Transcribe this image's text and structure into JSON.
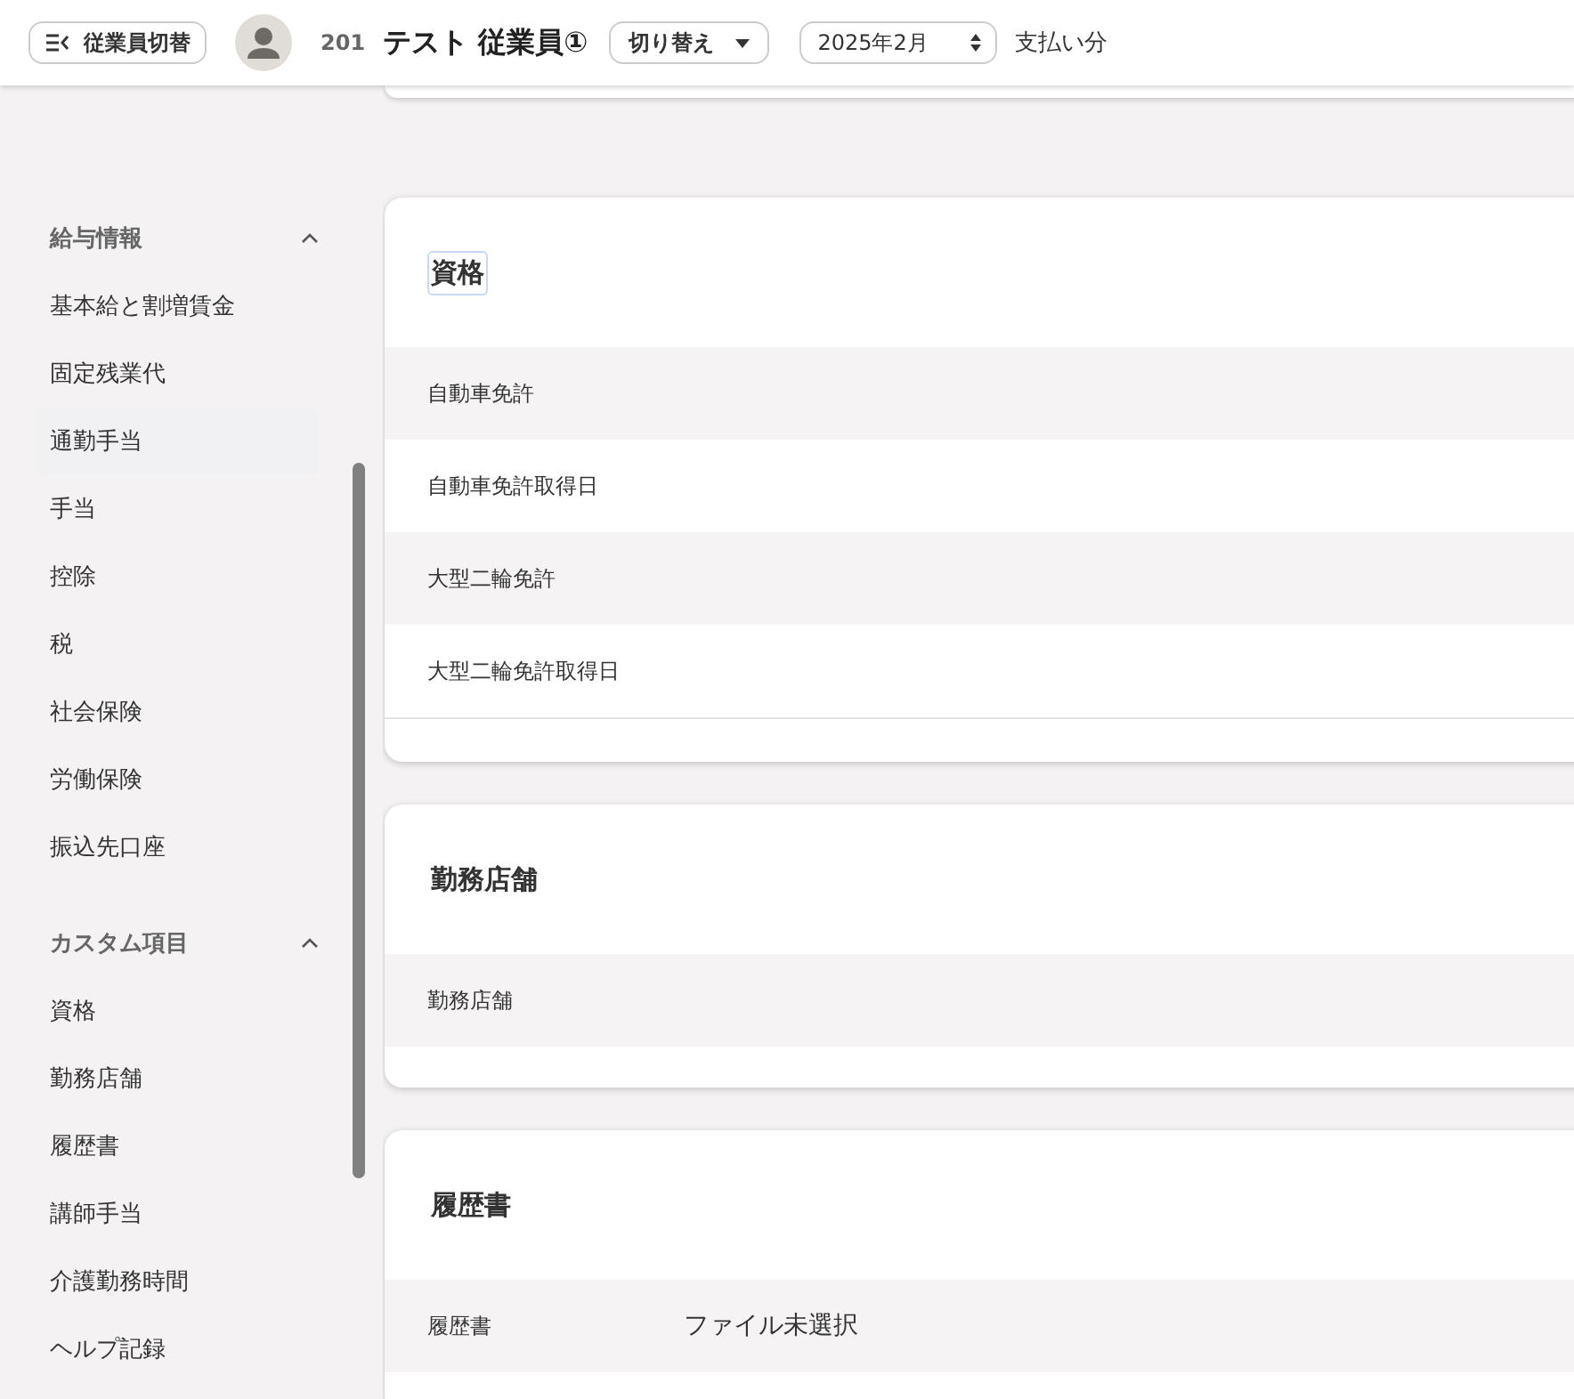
{
  "header": {
    "switch_button": "従業員切替",
    "employee_number": "201",
    "employee_name": "テスト 従業員①",
    "switch_dropdown": "切り替え",
    "period_select": "2025年2月",
    "period_suffix": "支払い分"
  },
  "sidebar": {
    "sections": [
      {
        "title": "給与情報",
        "expanded": true,
        "items": [
          {
            "label": "基本給と割増賃金",
            "selected": false
          },
          {
            "label": "固定残業代",
            "selected": false
          },
          {
            "label": "通勤手当",
            "selected": true
          },
          {
            "label": "手当",
            "selected": false
          },
          {
            "label": "控除",
            "selected": false
          },
          {
            "label": "税",
            "selected": false
          },
          {
            "label": "社会保険",
            "selected": false
          },
          {
            "label": "労働保険",
            "selected": false
          },
          {
            "label": "振込先口座",
            "selected": false
          }
        ]
      },
      {
        "title": "カスタム項目",
        "expanded": true,
        "items": [
          {
            "label": "資格",
            "selected": false
          },
          {
            "label": "勤務店舗",
            "selected": false
          },
          {
            "label": "履歴書",
            "selected": false
          },
          {
            "label": "講師手当",
            "selected": false
          },
          {
            "label": "介護勤務時間",
            "selected": false
          },
          {
            "label": "ヘルプ記録",
            "selected": false
          }
        ]
      }
    ]
  },
  "cards": [
    {
      "title": "資格",
      "focused": true,
      "rows": [
        {
          "label": "自動車免許"
        },
        {
          "label": "自動車免許取得日"
        },
        {
          "label": "大型二輪免許"
        },
        {
          "label": "大型二輪免許取得日"
        }
      ]
    },
    {
      "title": "勤務店舗",
      "focused": false,
      "rows": [
        {
          "label": "勤務店舗"
        }
      ]
    },
    {
      "title": "履歴書",
      "focused": false,
      "rows": [
        {
          "label": "履歴書",
          "value": "ファイル未選択"
        }
      ]
    }
  ]
}
